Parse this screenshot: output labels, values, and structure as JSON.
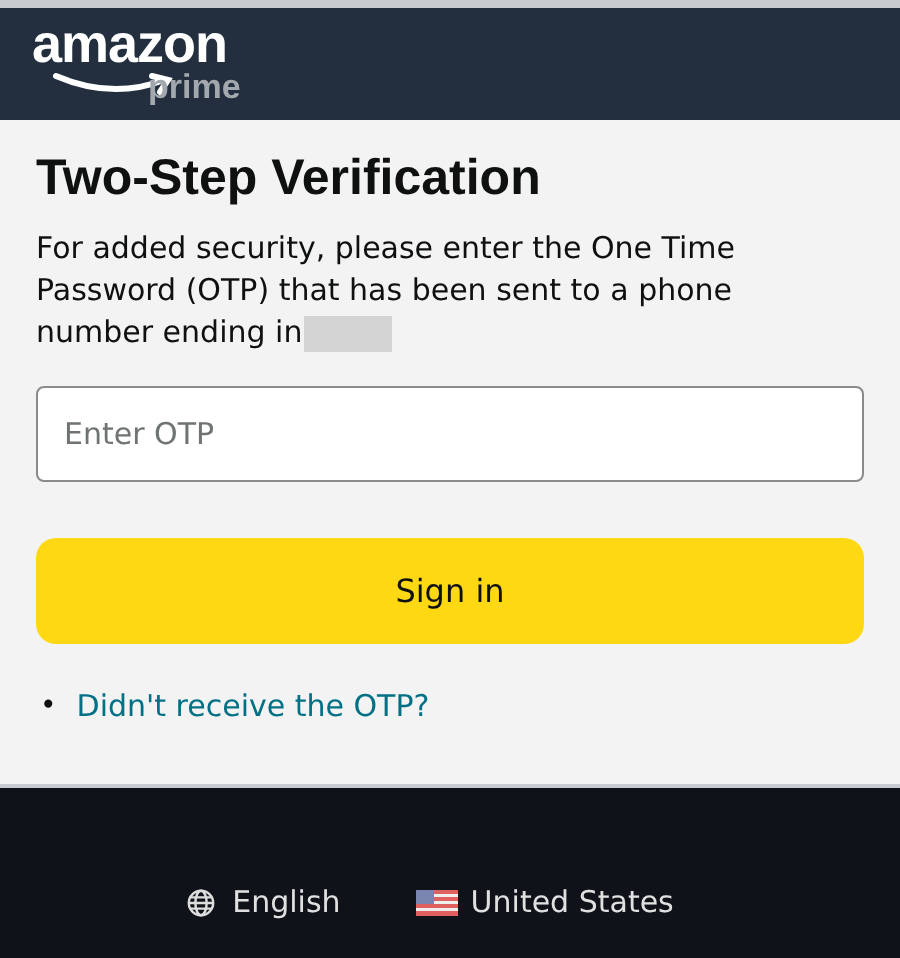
{
  "header": {
    "logo": {
      "wordmark": "amazon",
      "subbrand": "prime"
    }
  },
  "title": "Two-Step Verification",
  "message": "For added security, please enter the One Time Password (OTP) that has been sent to a phone number ending in",
  "otp_field": {
    "placeholder": "Enter OTP"
  },
  "sign_in_button": "Sign in",
  "help_link": {
    "bullet": "•",
    "label": "Didn't receive the OTP?"
  },
  "footer": {
    "language": "English",
    "country": "United States"
  }
}
